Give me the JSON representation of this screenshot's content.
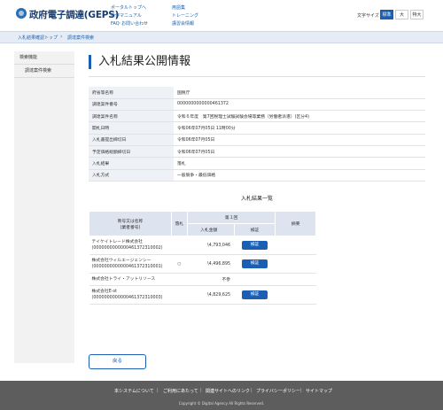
{
  "header": {
    "site_title": "政府電子調達(GEPS)",
    "nav_col1": [
      "ポータルトップへ",
      "操作マニュアル",
      "FAQ･お問い合わせ"
    ],
    "nav_col2": [
      "用語集",
      "トレーニング",
      "講習会情報"
    ],
    "font_size_label": "文字サイズ",
    "font_sizes": [
      "標準",
      "大",
      "特大"
    ]
  },
  "breadcrumb": [
    "入札結果確認トップ",
    "調達案件検索"
  ],
  "sidebar": {
    "heading": "検索機能",
    "items": [
      "調達案件検索"
    ]
  },
  "page_title": "入札結果公開情報",
  "info": [
    {
      "label": "府省等名称",
      "value": "国税庁"
    },
    {
      "label": "調達案件番号",
      "value": "0000000000000461372"
    },
    {
      "label": "調達案件名称",
      "value": "令和６年度　第7回税理士試験試験会場等業務（労働者派遣）(区分4)"
    },
    {
      "label": "開札日時",
      "value": "令和06年07月05日 11時00分"
    },
    {
      "label": "入札書提出締切日",
      "value": "令和06年07月05日"
    },
    {
      "label": "予定価格総額締切日",
      "value": "令和06年07月05日"
    },
    {
      "label": "入札結果",
      "value": "落札"
    },
    {
      "label": "入札方式",
      "value": "一般競争・最低価格"
    }
  ],
  "results": {
    "title": "入札結果一覧",
    "col_name": "商号又は名称",
    "col_name_sub": "(業者番号)",
    "col_flag": "落札",
    "col_round": "第１回",
    "col_amount": "入札金額",
    "col_verify": "検証",
    "col_note": "摘要",
    "verify_label": "検証",
    "rows": [
      {
        "name": "テイケイトレード株式会社",
        "code": "(0000000000000461372310002)",
        "flag": "",
        "amount": "\\4,793,046",
        "verify": true
      },
      {
        "name": "株式会社ウィルエージェンシー",
        "code": "(0000000000000461372310001)",
        "flag": "○",
        "amount": "\\4,496,895",
        "verify": true
      },
      {
        "name": "株式会社トライ・アットリソース",
        "code": "",
        "flag": "",
        "amount": "不参",
        "verify": false
      },
      {
        "name": "株式会社E-st",
        "code": "(0000000000000461372310003)",
        "flag": "",
        "amount": "\\4,829,625",
        "verify": true
      }
    ]
  },
  "back_label": "戻る",
  "footer": {
    "links": [
      "本システムについて",
      "ご利用にあたって",
      "関連サイトへのリンク",
      "プライバシーポリシー",
      "サイトマップ"
    ],
    "copyright": "Copyright © Digital Agency All Rights Reserved."
  }
}
